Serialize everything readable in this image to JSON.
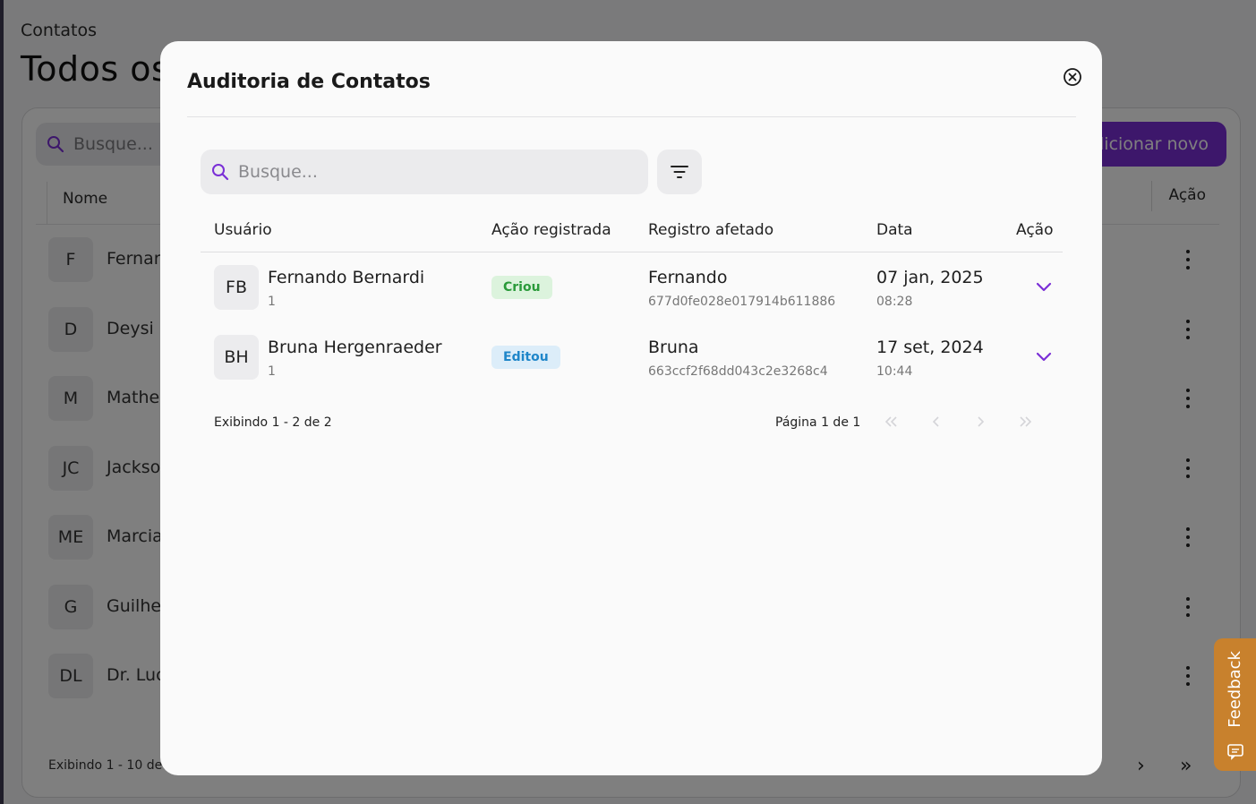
{
  "background": {
    "breadcrumb": "Contatos",
    "title": "Todos os",
    "search_placeholder": "Busque...",
    "add_button": "dicionar novo",
    "col_name": "Nome",
    "col_action": "Ação",
    "rows": [
      {
        "initials": "F",
        "name": "Fernar"
      },
      {
        "initials": "D",
        "name": "Deysi"
      },
      {
        "initials": "M",
        "name": "Mathe"
      },
      {
        "initials": "JC",
        "name": "Jackso"
      },
      {
        "initials": "ME",
        "name": "Marcia"
      },
      {
        "initials": "G",
        "name": "Guilhe"
      },
      {
        "initials": "DL",
        "name": "Dr. Luc"
      }
    ],
    "footer": "Exibindo 1 - 10 de",
    "feedback_label": "Feedback"
  },
  "modal": {
    "title": "Auditoria de Contatos",
    "search_placeholder": "Busque...",
    "headers": {
      "user": "Usuário",
      "action": "Ação registrada",
      "record": "Registro afetado",
      "date": "Data",
      "row_action": "Ação"
    },
    "rows": [
      {
        "initials": "FB",
        "user": "Fernando Bernardi",
        "user_sub": "1",
        "action": "Criou",
        "record": "Fernando",
        "record_id": "677d0fe028e017914b611886",
        "date": "07 jan, 2025",
        "time": "08:28"
      },
      {
        "initials": "BH",
        "user": "Bruna Hergenraeder",
        "user_sub": "1",
        "action": "Editou",
        "record": "Bruna",
        "record_id": "663ccf2f68dd043c2e3268c4",
        "date": "17 set, 2024",
        "time": "10:44"
      }
    ],
    "showing": "Exibindo 1 - 2 de 2",
    "page": "Página 1 de 1"
  },
  "colors": {
    "accent": "#7a2fd6",
    "created_badge_text": "#2a9a3a",
    "edited_badge_text": "#1f86c9",
    "feedback": "#c8812d"
  }
}
